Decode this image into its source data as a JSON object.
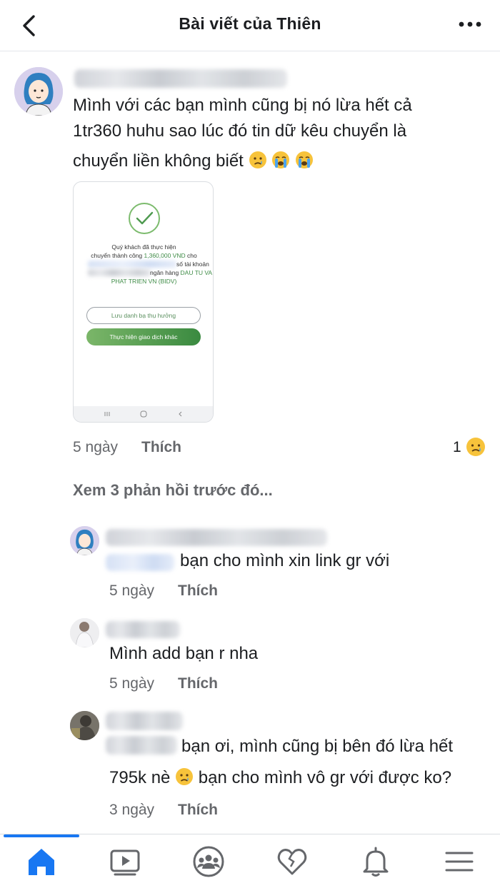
{
  "header": {
    "title": "Bài viết của Thiên"
  },
  "comment": {
    "text_lines": [
      "Mình với các bạn mình cũng bị nó lừa hết cả",
      "1tr360 huhu sao lúc đó tin dữ kêu chuyển là",
      "chuyển liền không biết"
    ],
    "receipt": {
      "line1": "Quý khách đã thực hiện",
      "line2a": "chuyển thành công ",
      "amount": "1,360,000 VND",
      "line2b": " cho",
      "line3": "số tài khoản",
      "line4a": "ngân hàng ",
      "bank1": "DAU TU VA",
      "bank2": "PHAT TRIEN VN (BIDV)",
      "btn_save": "Lưu danh bạ thụ hưởng",
      "btn_new": "Thực hiện giao dịch khác"
    },
    "time": "5 ngày",
    "like": "Thích",
    "reaction_count": "1"
  },
  "view_previous": "Xem 3 phản hồi trước đó...",
  "replies": [
    {
      "text": "bạn cho mình xin link gr với",
      "time": "5 ngày",
      "like": "Thích"
    },
    {
      "text": "Mình add bạn r nha",
      "time": "5 ngày",
      "like": "Thích"
    },
    {
      "text_line1": "bạn ơi, mình cũng bị bên đó lừa hết",
      "text_line2a": "795k nè",
      "text_line2b": "bạn cho mình vô gr với được ko?",
      "time": "3 ngày",
      "like": "Thích"
    }
  ],
  "icons": {
    "back": "chevron-left-icon",
    "more": "more-dots-icon",
    "home": "home-icon",
    "video": "video-icon",
    "groups": "groups-icon",
    "dating": "heart-icon",
    "notifications": "bell-icon",
    "menu": "menu-icon"
  },
  "colors": {
    "accent": "#1877f2",
    "secondary_text": "#65676b",
    "receipt_green": "#3f8c47"
  }
}
